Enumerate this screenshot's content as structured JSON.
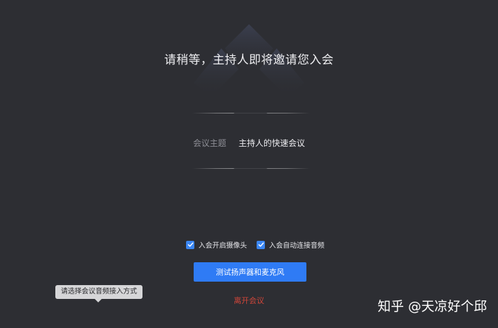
{
  "header": {
    "title": "请稍等，主持人即将邀请您入会"
  },
  "meeting": {
    "topic_label": "会议主题",
    "topic_value": "主持人的快速会议"
  },
  "options": [
    {
      "label": "入会开启摄像头",
      "checked": true
    },
    {
      "label": "入会自动连接音频",
      "checked": true
    }
  ],
  "actions": {
    "test_button_label": "测试扬声器和麦克风",
    "leave_label": "离开会议"
  },
  "tooltip": {
    "text": "请选择会议音频接入方式"
  },
  "watermark": {
    "text": "知乎 @天凉好个邱"
  },
  "colors": {
    "background": "#2d2e33",
    "accent": "#2f7bf5",
    "checkbox": "#3a86f3",
    "danger": "#d0463a"
  },
  "icons": {
    "logo": "tencent-meeting-logo-icon",
    "check": "checkmark-icon"
  }
}
